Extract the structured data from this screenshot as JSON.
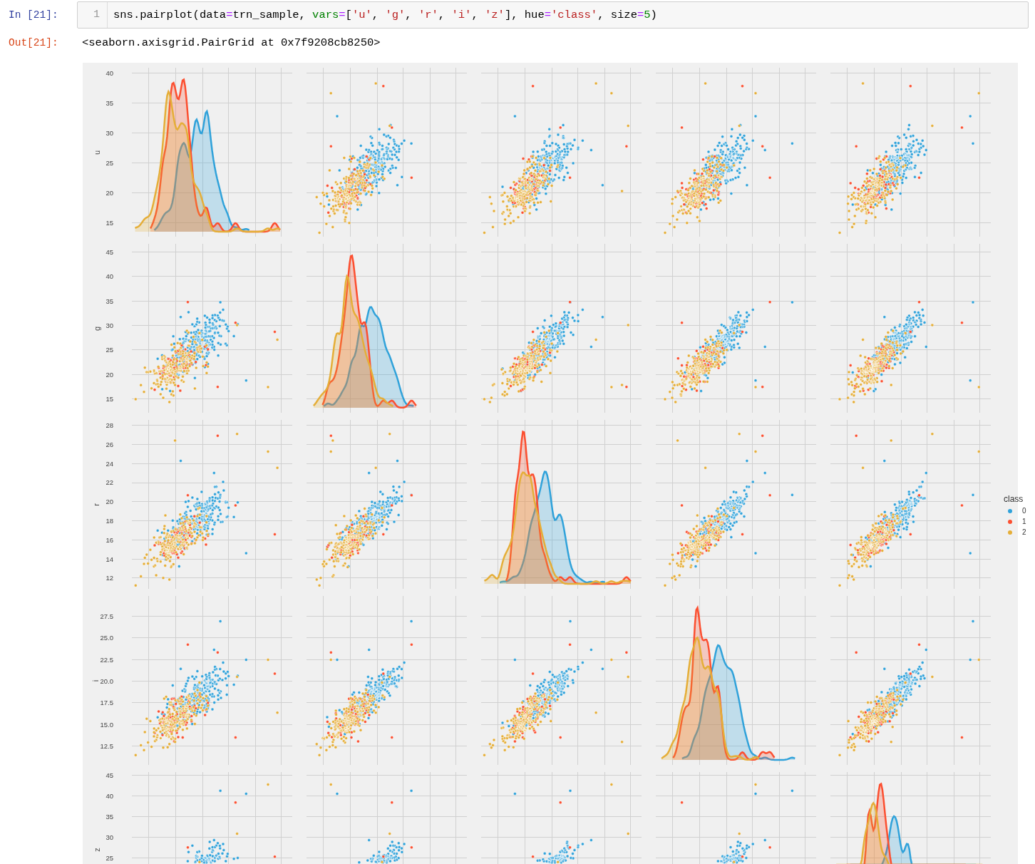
{
  "cell": {
    "prompt_in": "In [21]:",
    "line_number": "1",
    "code_tokens": [
      {
        "kind": "plain",
        "text": "sns.pairplot(data"
      },
      {
        "kind": "operator",
        "text": "="
      },
      {
        "kind": "plain",
        "text": "trn_sample, "
      },
      {
        "kind": "builtin",
        "text": "vars"
      },
      {
        "kind": "operator",
        "text": "="
      },
      {
        "kind": "plain",
        "text": "["
      },
      {
        "kind": "string",
        "text": "'u'"
      },
      {
        "kind": "plain",
        "text": ", "
      },
      {
        "kind": "string",
        "text": "'g'"
      },
      {
        "kind": "plain",
        "text": ", "
      },
      {
        "kind": "string",
        "text": "'r'"
      },
      {
        "kind": "plain",
        "text": ", "
      },
      {
        "kind": "string",
        "text": "'i'"
      },
      {
        "kind": "plain",
        "text": ", "
      },
      {
        "kind": "string",
        "text": "'z'"
      },
      {
        "kind": "plain",
        "text": "], hue"
      },
      {
        "kind": "operator",
        "text": "="
      },
      {
        "kind": "string",
        "text": "'class'"
      },
      {
        "kind": "plain",
        "text": ", size"
      },
      {
        "kind": "operator",
        "text": "="
      },
      {
        "kind": "number",
        "text": "5"
      },
      {
        "kind": "plain",
        "text": ")"
      }
    ],
    "prompt_out": "Out[21]:",
    "output": "<seaborn.axisgrid.PairGrid at 0x7f9208cb8250>"
  },
  "pairplot": {
    "rows": [
      {
        "label": "u",
        "ticks": [
          "40",
          "35",
          "30",
          "25",
          "20",
          "15"
        ]
      },
      {
        "label": "g",
        "ticks": [
          "45",
          "40",
          "35",
          "30",
          "25",
          "20",
          "15"
        ]
      },
      {
        "label": "r",
        "ticks": [
          "28",
          "26",
          "24",
          "22",
          "20",
          "18",
          "16",
          "14",
          "12"
        ]
      },
      {
        "label": "i",
        "ticks": [
          "27.5",
          "25.0",
          "22.5",
          "20.0",
          "17.5",
          "15.0",
          "12.5"
        ]
      },
      {
        "label": "z",
        "ticks": [
          "45",
          "40",
          "35",
          "30",
          "25"
        ]
      }
    ],
    "legend": {
      "title": "class",
      "items": [
        {
          "label": "0",
          "color": "#30a2da"
        },
        {
          "label": "1",
          "color": "#fc4f30"
        },
        {
          "label": "2",
          "color": "#e5ae38"
        }
      ]
    }
  }
}
